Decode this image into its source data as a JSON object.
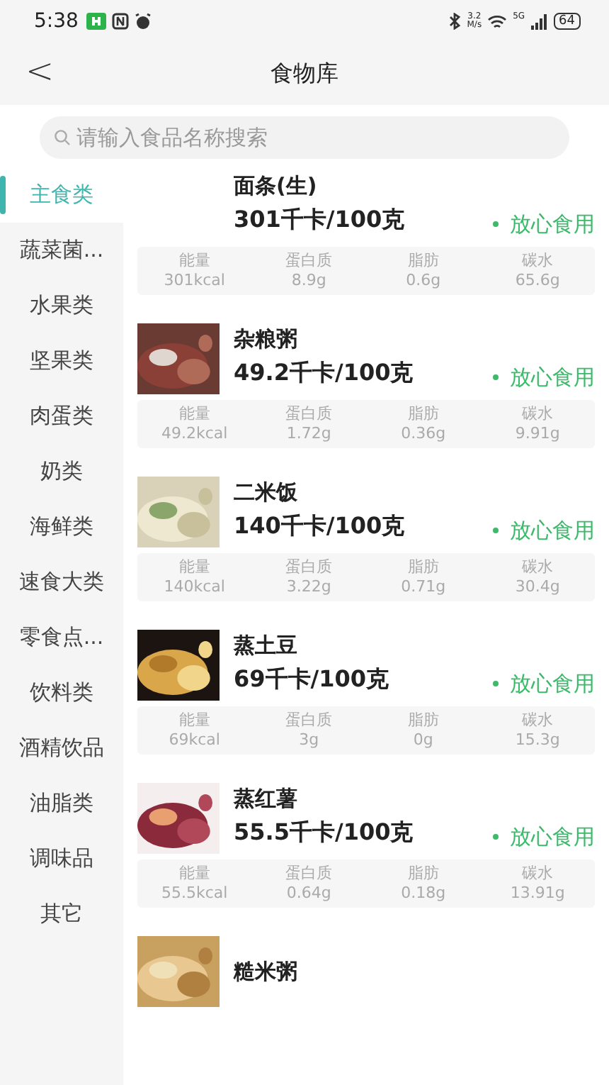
{
  "status_bar": {
    "time": "5:38",
    "speed_value": "3.2",
    "speed_unit": "M/s",
    "network": "5G",
    "battery": "64"
  },
  "header": {
    "back": "<",
    "title": "食物库"
  },
  "search": {
    "placeholder": "请输入食品名称搜索"
  },
  "categories": [
    {
      "label": "主食类",
      "selected": true
    },
    {
      "label": "蔬菜菌...",
      "selected": false
    },
    {
      "label": "水果类",
      "selected": false
    },
    {
      "label": "坚果类",
      "selected": false
    },
    {
      "label": "肉蛋类",
      "selected": false
    },
    {
      "label": "奶类",
      "selected": false
    },
    {
      "label": "海鲜类",
      "selected": false
    },
    {
      "label": "速食大类",
      "selected": false
    },
    {
      "label": "零食点...",
      "selected": false
    },
    {
      "label": "饮料类",
      "selected": false
    },
    {
      "label": "酒精饮品",
      "selected": false
    },
    {
      "label": "油脂类",
      "selected": false
    },
    {
      "label": "调味品",
      "selected": false
    },
    {
      "label": "其它",
      "selected": false
    }
  ],
  "foods": [
    {
      "name": "面条(生)",
      "calories": "301千卡/100克",
      "status": "放心食用",
      "nutrients": [
        {
          "label": "能量",
          "value": "301kcal"
        },
        {
          "label": "蛋白质",
          "value": "8.9g"
        },
        {
          "label": "脂肪",
          "value": "0.6g"
        },
        {
          "label": "碳水",
          "value": "65.6g"
        }
      ]
    },
    {
      "name": "杂粮粥",
      "calories": "49.2千卡/100克",
      "status": "放心食用",
      "nutrients": [
        {
          "label": "能量",
          "value": "49.2kcal"
        },
        {
          "label": "蛋白质",
          "value": "1.72g"
        },
        {
          "label": "脂肪",
          "value": "0.36g"
        },
        {
          "label": "碳水",
          "value": "9.91g"
        }
      ]
    },
    {
      "name": "二米饭",
      "calories": "140千卡/100克",
      "status": "放心食用",
      "nutrients": [
        {
          "label": "能量",
          "value": "140kcal"
        },
        {
          "label": "蛋白质",
          "value": "3.22g"
        },
        {
          "label": "脂肪",
          "value": "0.71g"
        },
        {
          "label": "碳水",
          "value": "30.4g"
        }
      ]
    },
    {
      "name": "蒸土豆",
      "calories": "69千卡/100克",
      "status": "放心食用",
      "nutrients": [
        {
          "label": "能量",
          "value": "69kcal"
        },
        {
          "label": "蛋白质",
          "value": "3g"
        },
        {
          "label": "脂肪",
          "value": "0g"
        },
        {
          "label": "碳水",
          "value": "15.3g"
        }
      ]
    },
    {
      "name": "蒸红薯",
      "calories": "55.5千卡/100克",
      "status": "放心食用",
      "nutrients": [
        {
          "label": "能量",
          "value": "55.5kcal"
        },
        {
          "label": "蛋白质",
          "value": "0.64g"
        },
        {
          "label": "脂肪",
          "value": "0.18g"
        },
        {
          "label": "碳水",
          "value": "13.91g"
        }
      ]
    },
    {
      "name": "糙米粥"
    }
  ]
}
